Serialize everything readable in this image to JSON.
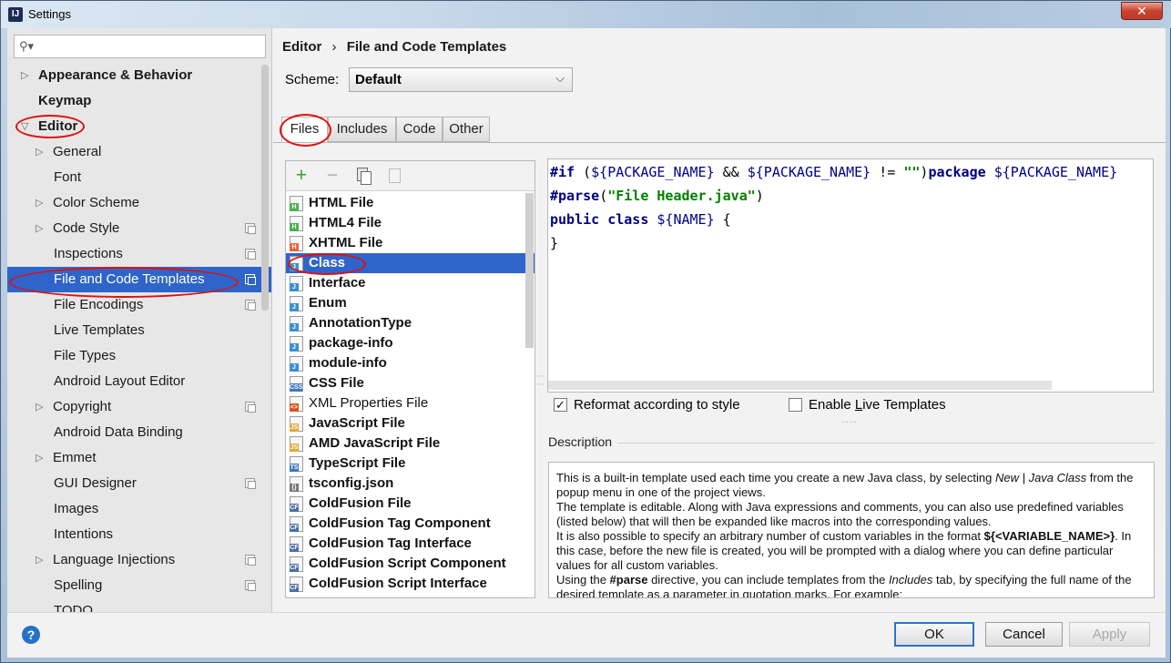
{
  "window": {
    "title": "Settings",
    "close_glyph": "✕"
  },
  "search": {
    "placeholder": ""
  },
  "sidebar": {
    "items": [
      {
        "label": "Appearance & Behavior"
      },
      {
        "label": "Keymap"
      },
      {
        "label": "Editor"
      },
      {
        "label": "General"
      },
      {
        "label": "Font"
      },
      {
        "label": "Color Scheme"
      },
      {
        "label": "Code Style"
      },
      {
        "label": "Inspections"
      },
      {
        "label": "File and Code Templates"
      },
      {
        "label": "File Encodings"
      },
      {
        "label": "Live Templates"
      },
      {
        "label": "File Types"
      },
      {
        "label": "Android Layout Editor"
      },
      {
        "label": "Copyright"
      },
      {
        "label": "Android Data Binding"
      },
      {
        "label": "Emmet"
      },
      {
        "label": "GUI Designer"
      },
      {
        "label": "Images"
      },
      {
        "label": "Intentions"
      },
      {
        "label": "Language Injections"
      },
      {
        "label": "Spelling"
      },
      {
        "label": "TODO"
      }
    ]
  },
  "header": {
    "section": "Editor",
    "separator": "›",
    "page": "File and Code Templates"
  },
  "scheme": {
    "label": "Scheme:",
    "value": "Default"
  },
  "tabs": [
    {
      "label": "Files"
    },
    {
      "label": "Includes"
    },
    {
      "label": "Code"
    },
    {
      "label": "Other"
    }
  ],
  "toolbar": {
    "add": "+",
    "remove": "−"
  },
  "templates": [
    {
      "label": "HTML File",
      "icon": "H",
      "color": "#4caf50"
    },
    {
      "label": "HTML4 File",
      "icon": "H",
      "color": "#4caf50"
    },
    {
      "label": "XHTML File",
      "icon": "H",
      "color": "#e8663d"
    },
    {
      "label": "Class",
      "icon": "J",
      "color": "#3d8fd1"
    },
    {
      "label": "Interface",
      "icon": "J",
      "color": "#3d8fd1"
    },
    {
      "label": "Enum",
      "icon": "J",
      "color": "#3d8fd1"
    },
    {
      "label": "AnnotationType",
      "icon": "J",
      "color": "#3d8fd1"
    },
    {
      "label": "package-info",
      "icon": "J",
      "color": "#3d8fd1"
    },
    {
      "label": "module-info",
      "icon": "J",
      "color": "#3d8fd1"
    },
    {
      "label": "CSS File",
      "icon": "CSS",
      "color": "#3d78c0"
    },
    {
      "label": "XML Properties File",
      "icon": "<>",
      "color": "#d9531e"
    },
    {
      "label": "JavaScript File",
      "icon": "JS",
      "color": "#e0a93a"
    },
    {
      "label": "AMD JavaScript File",
      "icon": "JS",
      "color": "#e0a93a"
    },
    {
      "label": "TypeScript File",
      "icon": "TS",
      "color": "#3d78c0"
    },
    {
      "label": "tsconfig.json",
      "icon": "{}",
      "color": "#777777"
    },
    {
      "label": "ColdFusion File",
      "icon": "CF",
      "color": "#4a6fa5"
    },
    {
      "label": "ColdFusion Tag Component",
      "icon": "CF",
      "color": "#4a6fa5"
    },
    {
      "label": "ColdFusion Tag Interface",
      "icon": "CF",
      "color": "#4a6fa5"
    },
    {
      "label": "ColdFusion Script Component",
      "icon": "CF",
      "color": "#4a6fa5"
    },
    {
      "label": "ColdFusion Script Interface",
      "icon": "CF",
      "color": "#4a6fa5"
    }
  ],
  "code": {
    "line1": {
      "a": "#if",
      "b": " (",
      "c": "${PACKAGE_NAME}",
      "d": " && ",
      "e": "${PACKAGE_NAME}",
      "f": " != ",
      "g": "\"\"",
      "h": ")",
      "i": "package",
      "j": " ",
      "k": "${PACKAGE_NAME}"
    },
    "line2": {
      "a": "#parse",
      "b": "(",
      "c": "\"File Header.java\"",
      "d": ")"
    },
    "line3": {
      "a": "public class",
      "b": " ",
      "c": "${NAME}",
      "d": " {"
    },
    "line4": "}"
  },
  "options": {
    "reformat": {
      "before": "Reformat according to style",
      "checked": true,
      "glyph": "✓"
    },
    "live": {
      "before": "Enable ",
      "underlined": "L",
      "after": "ive Templates",
      "checked": false
    }
  },
  "description": {
    "title": "Description",
    "p1a": "This is a built-in template used each time you create a new Java class, by selecting ",
    "p1b": "New | Java Class",
    "p1c": " from the popup menu in one of the project views.",
    "p2": "The template is editable. Along with Java expressions and comments, you can also use predefined variables (listed below) that will then be expanded like macros into the corresponding values.",
    "p3a": "It is also possible to specify an arbitrary number of custom variables in the format ",
    "p3b": "${<VARIABLE_NAME>}",
    "p3c": ". In this case, before the new file is created, you will be prompted with a dialog where you can define particular values for all custom variables.",
    "p4a": "Using the ",
    "p4b": "#parse",
    "p4c": " directive, you can include templates from the ",
    "p4d": "Includes",
    "p4e": " tab, by specifying the full name of the desired template as a parameter in quotation marks. For example:"
  },
  "buttons": {
    "ok": "OK",
    "cancel": "Cancel",
    "apply": "Apply",
    "help": "?"
  },
  "colors": {
    "selection": "#2f65ca",
    "annotation": "#e01010"
  }
}
